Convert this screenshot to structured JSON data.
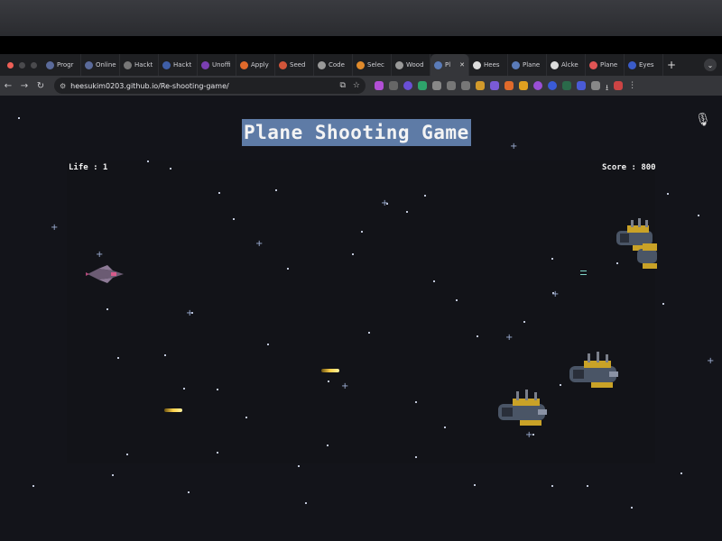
{
  "browser": {
    "tabs": [
      {
        "label": "Progr",
        "icon": "globe-icon",
        "color": "#5a6a9a"
      },
      {
        "label": "Online",
        "icon": "globe-icon",
        "color": "#5a6a9a"
      },
      {
        "label": "Hackt",
        "icon": "hack-icon",
        "color": "#777"
      },
      {
        "label": "Hackt",
        "icon": "un-icon",
        "color": "#3f5fa8"
      },
      {
        "label": "Unoffi",
        "icon": "circle-icon",
        "color": "#7b3fb3"
      },
      {
        "label": "Apply",
        "icon": "fire-icon",
        "color": "#e06a2b"
      },
      {
        "label": "Seed",
        "icon": "seed-icon",
        "color": "#d2553a"
      },
      {
        "label": "Code",
        "icon": "code-icon",
        "color": "#999"
      },
      {
        "label": "Selec",
        "icon": "z-icon",
        "color": "#e08a2b"
      },
      {
        "label": "Wood",
        "icon": "wood-icon",
        "color": "#999"
      },
      {
        "label": "Pl",
        "icon": "game-icon",
        "color": "#5a7bb8"
      },
      {
        "label": "Hees",
        "icon": "github-icon",
        "color": "#ddd"
      },
      {
        "label": "Plane",
        "icon": "plane-icon",
        "color": "#5a7bb8"
      },
      {
        "label": "Alcke",
        "icon": "github-icon",
        "color": "#ddd"
      },
      {
        "label": "Plane",
        "icon": "heart-icon",
        "color": "#e05555"
      },
      {
        "label": "Eyes",
        "icon": "eye-icon",
        "color": "#3a5bc8"
      }
    ],
    "new_tab_label": "+",
    "close_glyph": "✕",
    "url": "heesukim0203.github.io/Re-shooting-game/"
  },
  "game": {
    "title": "Plane Shooting Game",
    "life_label": "Life : 1",
    "score_label": "Score : 800"
  }
}
